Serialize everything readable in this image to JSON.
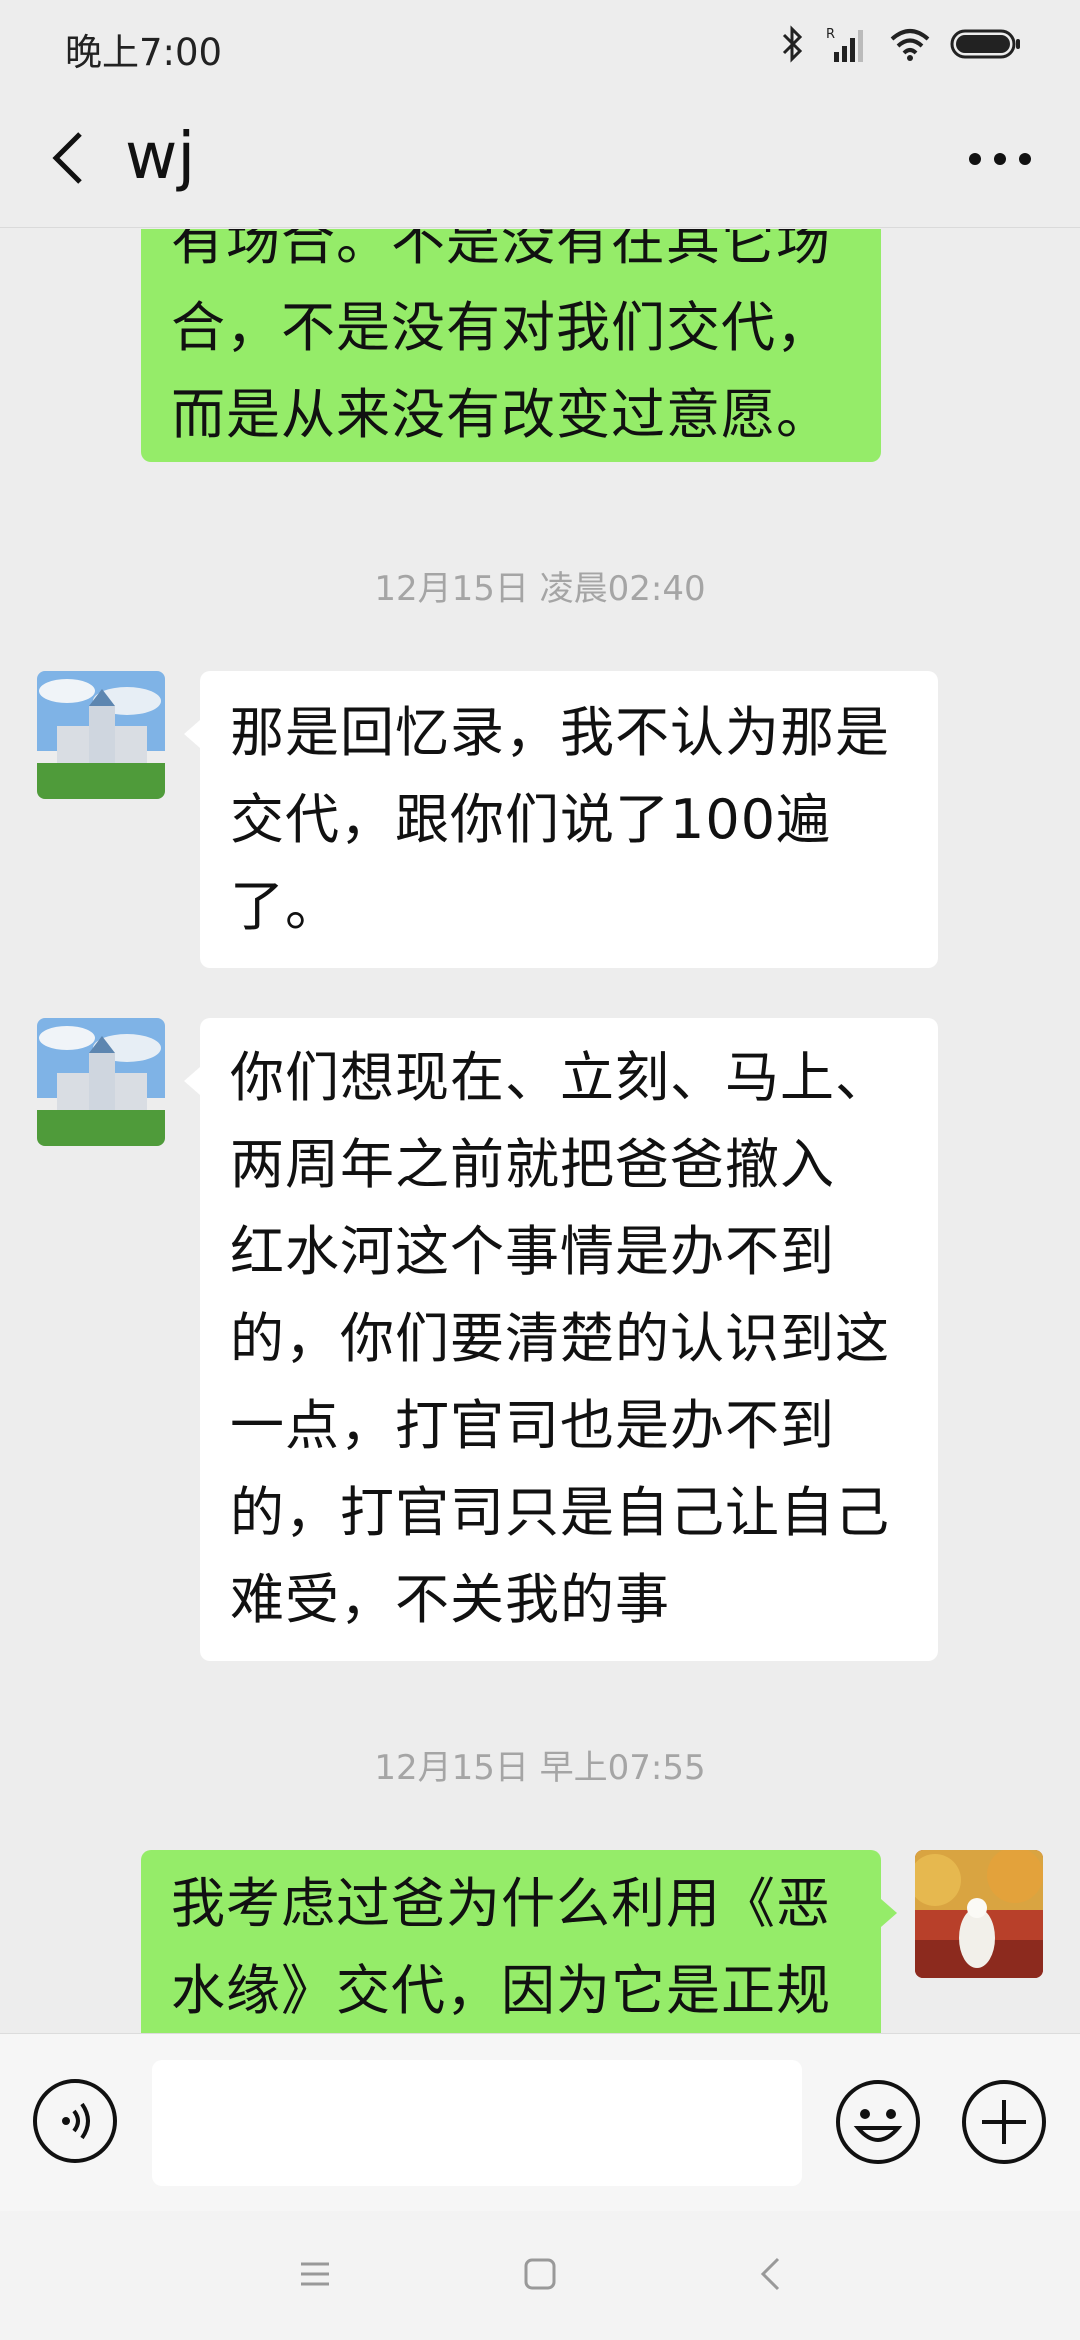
{
  "status_bar": {
    "time": "晚上7:00",
    "icons": [
      "bluetooth-icon",
      "signal-icon",
      "wifi-icon",
      "battery-icon"
    ]
  },
  "header": {
    "title": "wj",
    "back_icon": "back-arrow-icon",
    "more_icon": "more-dots-icon"
  },
  "messages": [
    {
      "direction": "out",
      "text": "有场合。不是没有在其它场\n合，不是没有对我们交代，\n而是从来没有改变过意愿。"
    },
    {
      "timestamp": "12月15日 凌晨02:40"
    },
    {
      "direction": "in",
      "text": "那是回忆录，我不认为那是\n交代，跟你们说了100遍\n了。"
    },
    {
      "direction": "in",
      "text": "你们想现在、立刻、马上、\n两周年之前就把爸爸撤入\n红水河这个事情是办不到\n的，你们要清楚的认识到这\n一点，打官司也是办不到\n的，打官司只是自己让自己\n难受，不关我的事"
    },
    {
      "timestamp": "12月15日 早上07:55"
    },
    {
      "direction": "out",
      "text": "我考虑过爸为什么利用《恶\n水缘》交代，因为它是正规"
    }
  ],
  "input_bar": {
    "value": "",
    "placeholder": "",
    "voice_icon": "voice-icon",
    "emoji_icon": "emoji-icon",
    "plus_icon": "plus-icon"
  },
  "colors": {
    "background": "#ededed",
    "outgoing_bubble": "#95ec69",
    "incoming_bubble": "#ffffff",
    "timestamp_text": "#a5a5a5"
  }
}
